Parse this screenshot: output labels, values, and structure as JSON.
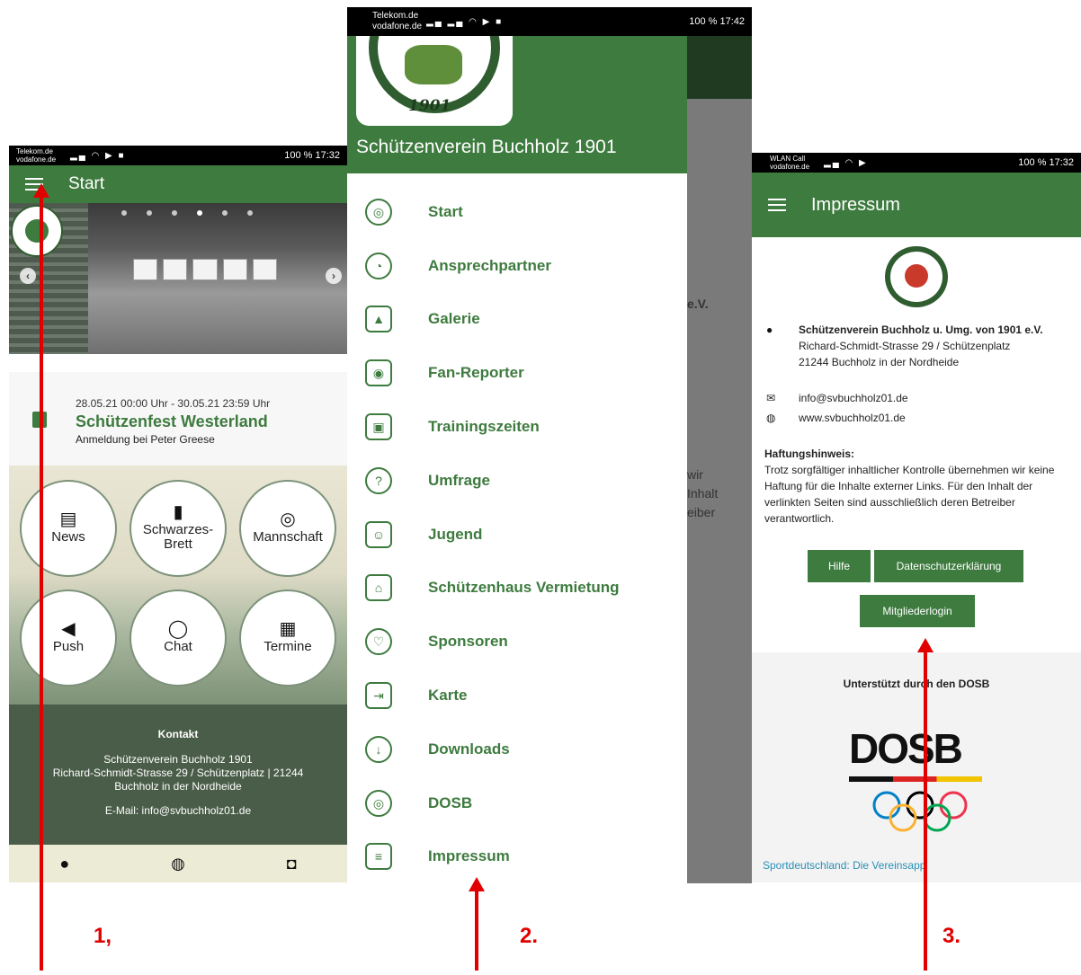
{
  "phone1": {
    "status": {
      "carrier": "Telekom.de vodafone.de",
      "right": "100 % 17:32"
    },
    "title": "Start",
    "event": {
      "date": "28.05.21 00:00 Uhr - 30.05.21 23:59 Uhr",
      "name": "Schützenfest Westerland",
      "sub": "Anmeldung bei Peter Greese"
    },
    "tiles": [
      {
        "label": "News",
        "icon": "newspaper-icon",
        "glyph": "▤"
      },
      {
        "label": "Schwarzes-Brett",
        "icon": "clipboard-icon",
        "glyph": "▮"
      },
      {
        "label": "Mannschaft",
        "icon": "target-icon",
        "glyph": "◎"
      },
      {
        "label": "Push",
        "icon": "megaphone-icon",
        "glyph": "◀"
      },
      {
        "label": "Chat",
        "icon": "chat-icon",
        "glyph": "◯"
      },
      {
        "label": "Termine",
        "icon": "calendar-icon",
        "glyph": "▦"
      }
    ],
    "contact": {
      "head": "Kontakt",
      "line1": "Schützenverein Buchholz 1901",
      "line2": "Richard-Schmidt-Strasse 29 / Schützenplatz | 21244",
      "line3": "Buchholz in der Nordheide",
      "mail": "E-Mail: info@svbuchholz01.de"
    },
    "bottom": [
      {
        "icon": "facebook-icon",
        "glyph": "●"
      },
      {
        "icon": "globe-icon",
        "glyph": "◍"
      },
      {
        "icon": "instagram-icon",
        "glyph": "◘"
      }
    ]
  },
  "phone2": {
    "status": {
      "carrier": "Telekom.de vodafone.de",
      "right": "100 % 17:42"
    },
    "year": "1901",
    "title": "Schützenverein Buchholz 1901",
    "behind": {
      "ev": "e.V.",
      "t1": "wir",
      "t2": "Inhalt",
      "t3": "eiber"
    },
    "menu": [
      {
        "label": "Start",
        "icon": "target-start-icon",
        "glyph": "◎"
      },
      {
        "label": "Ansprechpartner",
        "icon": "people-icon",
        "glyph": "◔"
      },
      {
        "label": "Galerie",
        "icon": "gallery-icon",
        "glyph": "▲"
      },
      {
        "label": "Fan-Reporter",
        "icon": "camera-icon",
        "glyph": "◉"
      },
      {
        "label": "Trainingszeiten",
        "icon": "calendar-icon",
        "glyph": "▣"
      },
      {
        "label": "Umfrage",
        "icon": "question-icon",
        "glyph": "?"
      },
      {
        "label": "Jugend",
        "icon": "badge-icon",
        "glyph": "☺"
      },
      {
        "label": "Schützenhaus Vermietung",
        "icon": "house-icon",
        "glyph": "⌂"
      },
      {
        "label": "Sponsoren",
        "icon": "heart-hand-icon",
        "glyph": "♡"
      },
      {
        "label": "Karte",
        "icon": "signpost-icon",
        "glyph": "⇥"
      },
      {
        "label": "Downloads",
        "icon": "download-icon",
        "glyph": "↓"
      },
      {
        "label": "DOSB",
        "icon": "dosb-target-icon",
        "glyph": "◎"
      },
      {
        "label": "Impressum",
        "icon": "clipboard-list-icon",
        "glyph": "≡"
      }
    ]
  },
  "phone3": {
    "status": {
      "carrier": "WLAN Call vodafone.de",
      "right": "100 % 17:32"
    },
    "title": "Impressum",
    "address": {
      "name": "Schützenverein Buchholz u. Umg. von 1901 e.V.",
      "street": "Richard-Schmidt-Strasse 29 / Schützenplatz",
      "city": "21244 Buchholz in der Nordheide"
    },
    "email": "info@svbuchholz01.de",
    "web": "www.svbuchholz01.de",
    "haftung_title": "Haftungshinweis:",
    "haftung_text": "Trotz sorgfältiger inhaltlicher Kontrolle übernehmen wir keine Haftung für die Inhalte externer Links. Für den Inhalt der verlinkten Seiten sind ausschließlich deren Betreiber verantwortlich.",
    "buttons": {
      "hilfe": "Hilfe",
      "datenschutz": "Datenschutzerklärung",
      "login": "Mitgliederlogin"
    },
    "dosb_head": "Unterstützt durch den DOSB",
    "dosb_logo": "DOSB",
    "dosb_link": "Sportdeutschland: Die Vereinsapp"
  },
  "annotations": {
    "step1": "1,",
    "step2": "2.",
    "step3": "3."
  },
  "colors": {
    "brand_green": "#3e7b3f",
    "arrow_red": "#e10000"
  }
}
